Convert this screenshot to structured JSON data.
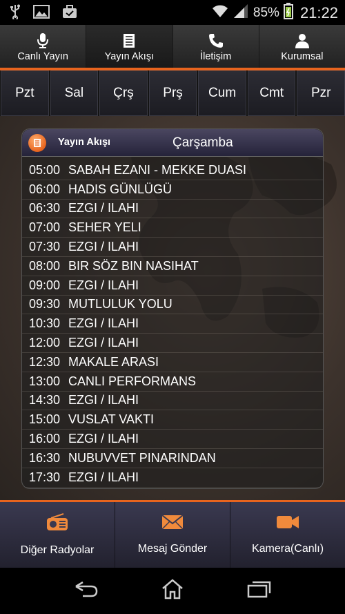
{
  "status_bar": {
    "battery_percent": "85%",
    "time": "21:22",
    "icons": [
      "usb-icon",
      "image-icon",
      "briefcase-icon",
      "wifi-icon",
      "signal-icon",
      "battery-icon"
    ]
  },
  "tabs": [
    {
      "label": "Canlı Yayın",
      "icon": "microphone-icon",
      "active": false
    },
    {
      "label": "Yayın Akışı",
      "icon": "list-icon",
      "active": true
    },
    {
      "label": "İletişim",
      "icon": "phone-icon",
      "active": false
    },
    {
      "label": "Kurumsal",
      "icon": "person-icon",
      "active": false
    }
  ],
  "days": [
    "Pzt",
    "Sal",
    "Çrş",
    "Prş",
    "Cum",
    "Cmt",
    "Pzr"
  ],
  "schedule": {
    "title": "Yayın Akışı",
    "day": "Çarşamba",
    "items": [
      {
        "time": "05:00",
        "program": "SABAH EZANI - MEKKE DUASI"
      },
      {
        "time": "06:00",
        "program": "HADIS GÜNLÜGÜ"
      },
      {
        "time": "06:30",
        "program": "EZGI / ILAHI"
      },
      {
        "time": "07:00",
        "program": "SEHER YELI"
      },
      {
        "time": "07:30",
        "program": "EZGI / ILAHI"
      },
      {
        "time": "08:00",
        "program": "BIR SÖZ BIN NASIHAT"
      },
      {
        "time": "09:00",
        "program": "EZGI / ILAHI"
      },
      {
        "time": "09:30",
        "program": "MUTLULUK YOLU"
      },
      {
        "time": "10:30",
        "program": "EZGI / ILAHI"
      },
      {
        "time": "12:00",
        "program": "EZGI / ILAHI"
      },
      {
        "time": "12:30",
        "program": "MAKALE ARASI"
      },
      {
        "time": "13:00",
        "program": "CANLI PERFORMANS"
      },
      {
        "time": "14:30",
        "program": "EZGI / ILAHI"
      },
      {
        "time": "15:00",
        "program": "VUSLAT VAKTI"
      },
      {
        "time": "16:00",
        "program": "EZGI / ILAHI"
      },
      {
        "time": "16:30",
        "program": "NUBUVVET PINARINDAN"
      },
      {
        "time": "17:30",
        "program": "EZGI / ILAHI"
      }
    ]
  },
  "actions": [
    {
      "label": "Diğer Radyolar",
      "icon": "radio-icon"
    },
    {
      "label": "Mesaj Gönder",
      "icon": "envelope-icon"
    },
    {
      "label": "Kamera(Canlı)",
      "icon": "video-camera-icon"
    }
  ],
  "colors": {
    "accent": "#e8641e",
    "tab_bg": "#2a2a2a",
    "bottom_bar_bg": "#2e2d40"
  }
}
